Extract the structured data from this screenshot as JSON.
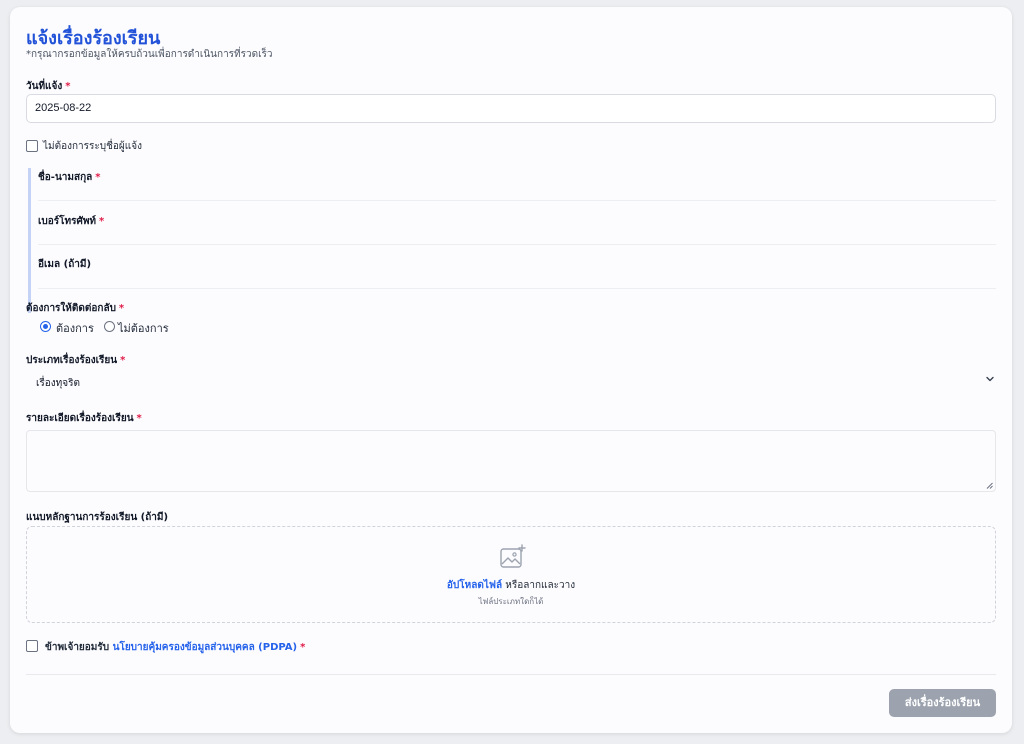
{
  "form": {
    "title": "แจ้งเรื่องร้องเรียน",
    "subtitle": "*กรุณากรอกข้อมูลให้ครบถ้วนเพื่อการดำเนินการที่รวดเร็ว",
    "required_mark": "*"
  },
  "report_date": {
    "label": "วันที่แจ้ง",
    "value": "2025-08-22"
  },
  "anonymous": {
    "label": "ไม่ต้องการระบุชื่อผู้แจ้ง",
    "checked": false
  },
  "contact": {
    "name_label": "ชื่อ-นามสกุล",
    "name_value": "",
    "phone_label": "เบอร์โทรศัพท์",
    "phone_value": "",
    "email_label": "อีเมล (ถ้ามี)",
    "email_value": "",
    "callback_label": "ต้องการให้ติดต่อกลับ",
    "callback_options": [
      "ต้องการ",
      "ไม่ต้องการ"
    ],
    "callback_selected": "ต้องการ"
  },
  "complaint_type": {
    "label": "ประเภทเรื่องร้องเรียน",
    "value": "เรื่องทุจริต"
  },
  "details": {
    "label": "รายละเอียดเรื่องร้องเรียน",
    "value": ""
  },
  "attachment": {
    "label": "แนบหลักฐานการร้องเรียน (ถ้ามี)",
    "upload_link": "อัปโหลดไฟล์",
    "upload_text": "หรือลากและวาง",
    "hint": "ไฟล์ประเภทใดก็ได้",
    "icon": "image-plus-icon"
  },
  "consent": {
    "prefix": "ข้าพเจ้ายอมรับ",
    "link": "นโยบายคุ้มครองข้อมูลส่วนบุคคล (PDPA)",
    "checked": false
  },
  "submit_label": "ส่งเรื่องร้องเรียน",
  "colors": {
    "accent": "#2152d8",
    "link": "#2563eb",
    "required": "#e11d48",
    "button_disabled": "#9ca3af",
    "section_bar": "#c4d2f5"
  }
}
